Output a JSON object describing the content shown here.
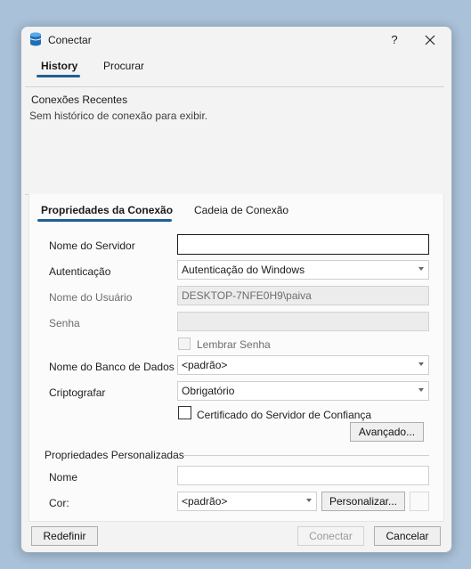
{
  "window": {
    "title": "Conectar",
    "help_label": "?",
    "close_label": "✕"
  },
  "top_tabs": [
    {
      "label": "History",
      "active": true
    },
    {
      "label": "Procurar",
      "active": false
    }
  ],
  "recent": {
    "title": "Conexões Recentes",
    "empty_text": "Sem histórico de conexão para exibir."
  },
  "prop_tabs": [
    {
      "label": "Propriedades da Conexão",
      "active": true
    },
    {
      "label": "Cadeia de Conexão",
      "active": false
    }
  ],
  "form": {
    "server_label": "Nome do Servidor",
    "server_value": "",
    "auth_label": "Autenticação",
    "auth_value": "Autenticação do Windows",
    "user_label": "Nome do Usuário",
    "user_value": "DESKTOP-7NFE0H9\\paiva",
    "password_label": "Senha",
    "password_value": "",
    "remember_label": "Lembrar Senha",
    "remember_checked": false,
    "db_label": "Nome do Banco de Dados",
    "db_value": "<padrão>",
    "encrypt_label": "Criptografar",
    "encrypt_value": "Obrigatório",
    "trust_cert_label": "Certificado do Servidor de Confiança",
    "trust_cert_checked": false,
    "advanced_label": "Avançado..."
  },
  "custom": {
    "group_label": "Propriedades Personalizadas",
    "name_label": "Nome",
    "name_value": "",
    "color_label": "Cor:",
    "color_value": "<padrão>",
    "customize_label": "Personalizar..."
  },
  "footer": {
    "reset_label": "Redefinir",
    "connect_label": "Conectar",
    "cancel_label": "Cancelar"
  },
  "colors": {
    "accent": "#1f5f95",
    "background": "#a9c1d9"
  },
  "icons": {
    "app": "database-icon",
    "close": "close-icon",
    "help": "help-icon"
  }
}
